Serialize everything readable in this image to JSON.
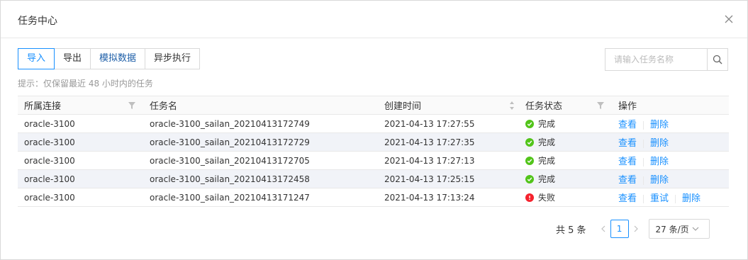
{
  "modal": {
    "title": "任务中心",
    "close_icon": "close-icon"
  },
  "toolbar": {
    "buttons": [
      "导入",
      "导出",
      "模拟数据",
      "异步执行"
    ]
  },
  "search": {
    "placeholder": "请输入任务名称",
    "icon": "search-icon"
  },
  "tip": "提示：仅保留最近 48 小时内的任务",
  "table": {
    "columns": [
      "所属连接",
      "任务名",
      "创建时间",
      "任务状态",
      "操作"
    ],
    "rows": [
      {
        "conn": "oracle-3100",
        "name": "oracle-3100_sailan_20210413172749",
        "time": "2021-04-13 17:27:55",
        "status": "完成",
        "status_type": "success",
        "actions": [
          "查看",
          "删除"
        ]
      },
      {
        "conn": "oracle-3100",
        "name": "oracle-3100_sailan_20210413172729",
        "time": "2021-04-13 17:27:35",
        "status": "完成",
        "status_type": "success",
        "actions": [
          "查看",
          "删除"
        ]
      },
      {
        "conn": "oracle-3100",
        "name": "oracle-3100_sailan_20210413172705",
        "time": "2021-04-13 17:27:13",
        "status": "完成",
        "status_type": "success",
        "actions": [
          "查看",
          "删除"
        ]
      },
      {
        "conn": "oracle-3100",
        "name": "oracle-3100_sailan_20210413172458",
        "time": "2021-04-13 17:25:15",
        "status": "完成",
        "status_type": "success",
        "actions": [
          "查看",
          "删除"
        ]
      },
      {
        "conn": "oracle-3100",
        "name": "oracle-3100_sailan_20210413171247",
        "time": "2021-04-13 17:13:24",
        "status": "失败",
        "status_type": "error",
        "actions": [
          "查看",
          "重试",
          "删除"
        ]
      }
    ]
  },
  "pagination": {
    "total": "共 5 条",
    "current": "1",
    "page_size": "27 条/页"
  },
  "colors": {
    "primary": "#1890ff",
    "success": "#52c41a",
    "error": "#f5222d",
    "alt_row": "#f1f3f8"
  }
}
